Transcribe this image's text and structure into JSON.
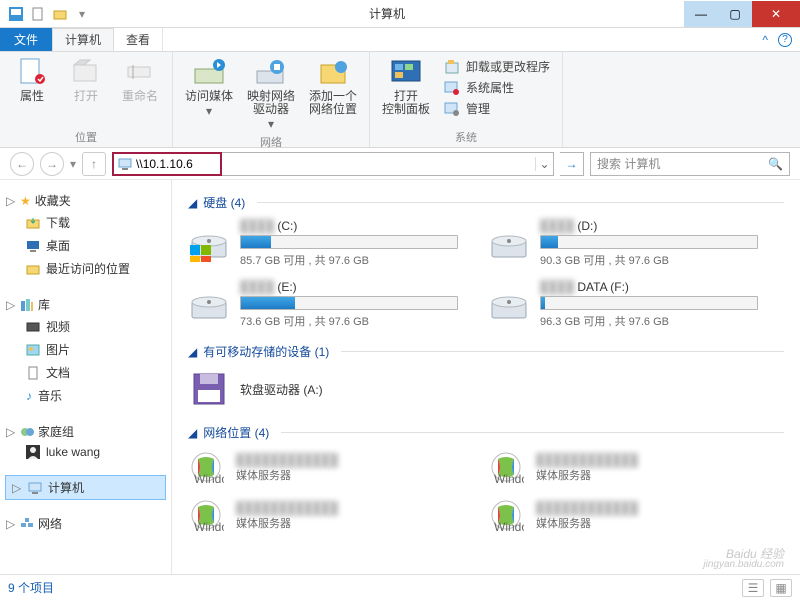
{
  "window": {
    "title": "计算机",
    "menu": {
      "file": "文件",
      "tabs": [
        "计算机",
        "查看"
      ]
    }
  },
  "ribbon": {
    "loc": {
      "properties": "属性",
      "open": "打开",
      "rename": "重命名",
      "group": "位置"
    },
    "net": {
      "media": "访问媒体",
      "map": "映射网络\n驱动器",
      "addloc": "添加一个\n网络位置",
      "group": "网络"
    },
    "sys": {
      "cp": "打开\n控制面板",
      "uninstall": "卸载或更改程序",
      "props": "系统属性",
      "manage": "管理",
      "group": "系统"
    }
  },
  "nav": {
    "address": "\\\\10.1.10.6",
    "search_placeholder": "搜索 计算机"
  },
  "sidebar": {
    "fav": {
      "head": "收藏夹",
      "items": [
        "下载",
        "桌面",
        "最近访问的位置"
      ]
    },
    "lib": {
      "head": "库",
      "items": [
        "视频",
        "图片",
        "文档",
        "音乐"
      ]
    },
    "home": {
      "head": "家庭组",
      "items": [
        "luke wang"
      ]
    },
    "computer": "计算机",
    "network": "网络"
  },
  "content": {
    "hd": {
      "head": "硬盘 (4)",
      "drives": [
        {
          "label": "(C:)",
          "free": "85.7 GB 可用 , 共 97.6 GB",
          "pct": 14
        },
        {
          "label": "(D:)",
          "free": "90.3 GB 可用 , 共 97.6 GB",
          "pct": 8
        },
        {
          "label": "(E:)",
          "free": "73.6 GB 可用 , 共 97.6 GB",
          "pct": 25
        },
        {
          "label": "DATA (F:)",
          "free": "96.3 GB 可用 , 共 97.6 GB",
          "pct": 2
        }
      ]
    },
    "rem": {
      "head": "有可移动存储的设备 (1)",
      "item": "软盘驱动器 (A:)"
    },
    "net": {
      "head": "网络位置 (4)",
      "sub": "媒体服务器"
    }
  },
  "status": {
    "count": "9 个项目"
  },
  "watermark": {
    "main": "Baidu 经验",
    "sub": "jingyan.baidu.com"
  }
}
